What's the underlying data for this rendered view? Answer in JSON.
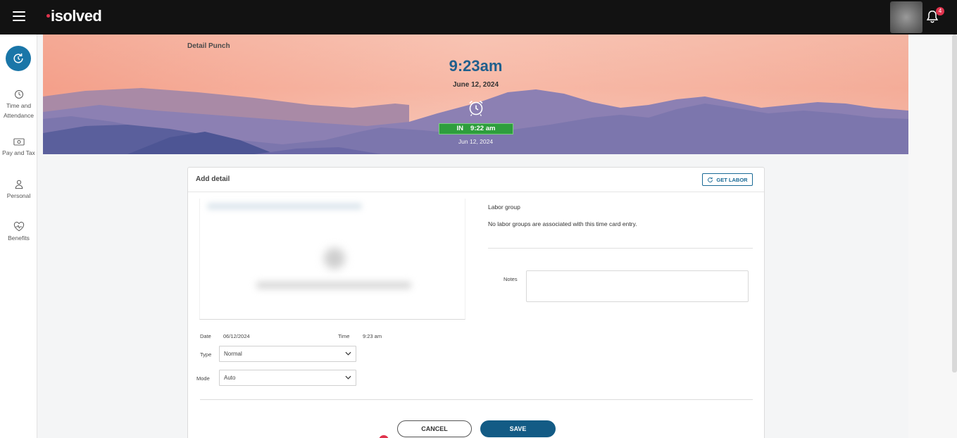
{
  "app": {
    "brand": "isolved",
    "notifications_count": "4"
  },
  "sidebar": {
    "items": [
      {
        "label_line1": "Time and",
        "label_line2": "Attendance",
        "icon": "clock-icon"
      },
      {
        "label": "Pay and Tax",
        "icon": "money-icon"
      },
      {
        "label": "Personal",
        "icon": "person-icon"
      },
      {
        "label": "Benefits",
        "icon": "heart-pulse-icon"
      }
    ]
  },
  "hero": {
    "title": "Detail Punch",
    "current_time": "9:23am",
    "current_date": "June 12, 2024",
    "punch_direction": "IN",
    "punch_time": "9:22 am",
    "punch_date": "Jun 12, 2024"
  },
  "card": {
    "title": "Add detail",
    "get_labor_label": "GET LABOR",
    "date_label": "Date",
    "date_value": "06/12/2024",
    "time_label": "Time",
    "time_value": "9:23 am",
    "type_label": "Type",
    "type_value": "Normal",
    "mode_label": "Mode",
    "mode_value": "Auto",
    "labor_group_title": "Labor group",
    "labor_group_text": "No labor groups are associated with this time card entry.",
    "notes_label": "Notes",
    "notes_value": "",
    "cancel_label": "CANCEL",
    "save_label": "SAVE"
  },
  "colors": {
    "topbar": "#121212",
    "accent": "#1a76a8",
    "save": "#135b85",
    "punch_in": "#2e9e3d",
    "brand_red": "#e0334d"
  }
}
